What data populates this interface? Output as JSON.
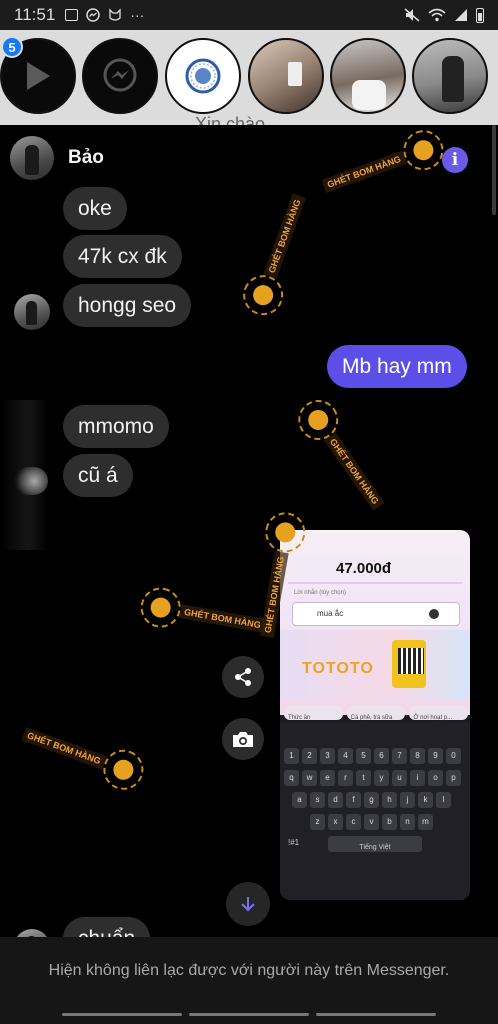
{
  "status_bar": {
    "time": "11:51",
    "dots": "···"
  },
  "chat_heads": {
    "unread_count": "5",
    "background_text": "Xin chào"
  },
  "chat": {
    "contact_name": "Bảo",
    "messages": [
      {
        "from": "them",
        "text": "oke"
      },
      {
        "from": "them",
        "text": "47k cx đk"
      },
      {
        "from": "them",
        "text": "hongg seo"
      },
      {
        "from": "me",
        "text": "Mb hay mm"
      },
      {
        "from": "them",
        "text": "mmomo"
      },
      {
        "from": "them",
        "text": "cũ á"
      },
      {
        "from": "them",
        "text": "chuẩn"
      }
    ],
    "image_message": {
      "price": "47.000đ",
      "field_label": "Lời nhắn (tùy chọn)",
      "field_value": "mua ắc",
      "promo_title": "TOTOTO",
      "chips": [
        "Thức ăn",
        "Cà phê, trà sữa",
        "Ở nơi hoạt p..."
      ],
      "keyboard_language": "Tiếng Việt",
      "keyboard_numbers": [
        "1",
        "2",
        "3",
        "4",
        "5",
        "6",
        "7",
        "8",
        "9",
        "0"
      ],
      "keyboard_row1": [
        "q",
        "w",
        "e",
        "r",
        "t",
        "y",
        "u",
        "i",
        "o",
        "p"
      ],
      "keyboard_row2": [
        "a",
        "s",
        "d",
        "f",
        "g",
        "h",
        "j",
        "k",
        "l"
      ],
      "keyboard_row3": [
        "z",
        "x",
        "c",
        "v",
        "b",
        "n",
        "m"
      ],
      "keyboard_symbols": "!#1"
    }
  },
  "watermark": {
    "text": "GHÉT BOM HÀNG"
  },
  "footer": {
    "notice": "Hiện không liên lạc được với người này trên Messenger."
  },
  "colors": {
    "my_bubble": "#5c4fe8",
    "their_bubble": "#2e2e2e",
    "info_icon": "#6a5ae8",
    "badge": "#1877f2"
  },
  "icons": [
    "gallery-icon",
    "messenger-icon",
    "mute-icon",
    "wifi-icon",
    "signal-icon",
    "battery-icon",
    "play-icon",
    "info-icon",
    "share-icon",
    "camera-icon",
    "arrow-down-icon"
  ]
}
